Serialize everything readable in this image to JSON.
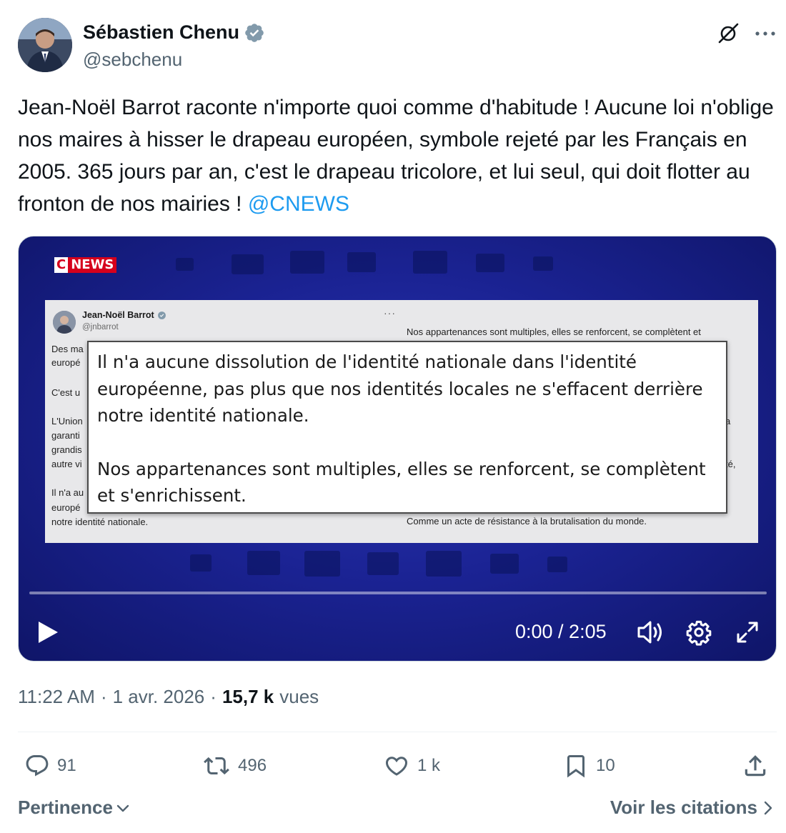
{
  "author": {
    "name": "Sébastien Chenu",
    "handle": "@sebchenu",
    "verified_icon": "verified-badge-icon",
    "verified_color": "#829aab"
  },
  "tweet": {
    "text": "Jean-Noël Barrot raconte n'importe quoi comme d'habitude ! Aucune loi n'oblige nos maires à hisser le drapeau européen, symbole rejeté par les Français en 2005. 365 jours par an, c'est le drapeau tricolore, et lui seul, qui doit flotter au fronton de nos mairies ! ",
    "mention": "@CNEWS",
    "mention_color": "#1d9bf0"
  },
  "video": {
    "channel_logo": {
      "c": "C",
      "news": "NEWS"
    },
    "embedded_post": {
      "name": "Jean-Noël Barrot",
      "handle": "@jnbarrot",
      "menu": "···",
      "right_line_top": "Nos appartenances sont multiples, elles se renforcent, se complètent et",
      "right_line_bottom": "Comme un acte de résistance à la brutalisation du monde.",
      "left_fragments": [
        "Des ma",
        "europé",
        "C'est u",
        "L'Union",
        "garanti",
        "grandis",
        "autre vi",
        "Il n'a au",
        "europé",
        "notre identité nationale."
      ],
      "right_fragments": [
        "a",
        "té,"
      ]
    },
    "caption": {
      "paragraph1": "Il n'a aucune dissolution de l'identité nationale dans l'identité européenne, pas plus que nos identités locales ne s'effacent derrière notre identité nationale.",
      "paragraph2": "Nos appartenances sont multiples, elles se renforcent, se complètent et s'enrichissent."
    },
    "progress_fraction": 0,
    "time": "0:00 / 2:05",
    "icons": [
      "play-icon",
      "volume-icon",
      "settings-gear-icon",
      "fullscreen-expand-icon"
    ]
  },
  "meta": {
    "time": "11:22 AM",
    "date": "1 avr. 2026",
    "separator": "·",
    "views_count": "15,7 k",
    "views_label": "vues"
  },
  "actions": {
    "replies": "91",
    "reposts": "496",
    "likes": "1 k",
    "bookmarks": "10"
  },
  "footer": {
    "sort_label": "Pertinence",
    "quotes_label": "Voir les citations"
  }
}
